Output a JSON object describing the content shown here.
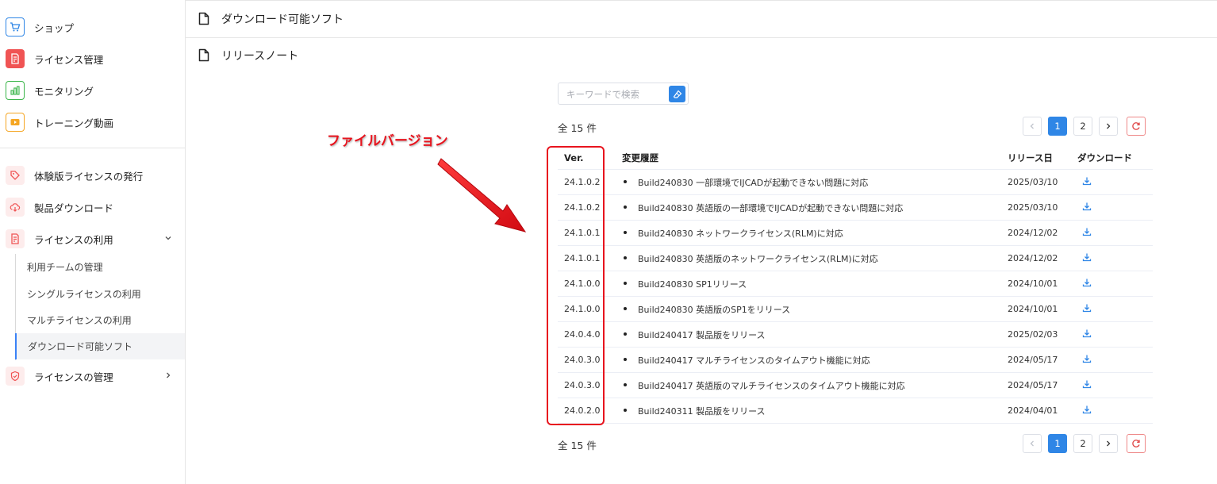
{
  "sidebar": {
    "top_items": [
      {
        "label": "ショップ",
        "icon": "cart-icon",
        "color": "#2f86e6"
      },
      {
        "label": "ライセンス管理",
        "icon": "license-icon",
        "color": "#f05454"
      },
      {
        "label": "モニタリング",
        "icon": "bar-chart-icon",
        "color": "#3bb54a"
      },
      {
        "label": "トレーニング動画",
        "icon": "play-icon",
        "color": "#f5a623"
      }
    ],
    "bottom_items": [
      {
        "label": "体験版ライセンスの発行",
        "icon": "tag-icon"
      },
      {
        "label": "製品ダウンロード",
        "icon": "cloud-download-icon"
      },
      {
        "label": "ライセンスの利用",
        "icon": "license-icon"
      },
      {
        "label": "ライセンスの管理",
        "icon": "shield-icon"
      }
    ],
    "sub_items": [
      {
        "label": "利用チームの管理"
      },
      {
        "label": "シングルライセンスの利用"
      },
      {
        "label": "マルチライセンスの利用"
      },
      {
        "label": "ダウンロード可能ソフト",
        "active": true
      }
    ]
  },
  "header": {
    "row1": "ダウンロード可能ソフト",
    "row2": "リリースノート"
  },
  "search": {
    "placeholder": "キーワードで検索"
  },
  "total": "全 15 件",
  "pagination": {
    "pages": [
      "1",
      "2"
    ],
    "current": "1"
  },
  "table": {
    "headers": {
      "ver": "Ver.",
      "history": "変更履歴",
      "date": "リリース日",
      "download": "ダウンロード"
    },
    "rows": [
      {
        "ver": "24.1.0.2",
        "history": "Build240830 一部環境でIJCADが起動できない問題に対応",
        "date": "2025/03/10"
      },
      {
        "ver": "24.1.0.2",
        "history": "Build240830 英語版の一部環境でIJCADが起動できない問題に対応",
        "date": "2025/03/10"
      },
      {
        "ver": "24.1.0.1",
        "history": "Build240830 ネットワークライセンス(RLM)に対応",
        "date": "2024/12/02"
      },
      {
        "ver": "24.1.0.1",
        "history": "Build240830 英語版のネットワークライセンス(RLM)に対応",
        "date": "2024/12/02"
      },
      {
        "ver": "24.1.0.0",
        "history": "Build240830 SP1リリース",
        "date": "2024/10/01"
      },
      {
        "ver": "24.1.0.0",
        "history": "Build240830 英語版のSP1をリリース",
        "date": "2024/10/01"
      },
      {
        "ver": "24.0.4.0",
        "history": "Build240417 製品版をリリース",
        "date": "2025/02/03"
      },
      {
        "ver": "24.0.3.0",
        "history": "Build240417 マルチライセンスのタイムアウト機能に対応",
        "date": "2024/05/17"
      },
      {
        "ver": "24.0.3.0",
        "history": "Build240417 英語版のマルチライセンスのタイムアウト機能に対応",
        "date": "2024/05/17"
      },
      {
        "ver": "24.0.2.0",
        "history": "Build240311 製品版をリリース",
        "date": "2024/04/01"
      }
    ]
  },
  "annotation": {
    "label": "ファイルバージョン",
    "color": "#e8141e"
  },
  "colors": {
    "accent": "#2f86e6",
    "border": "#e6e6e6"
  }
}
